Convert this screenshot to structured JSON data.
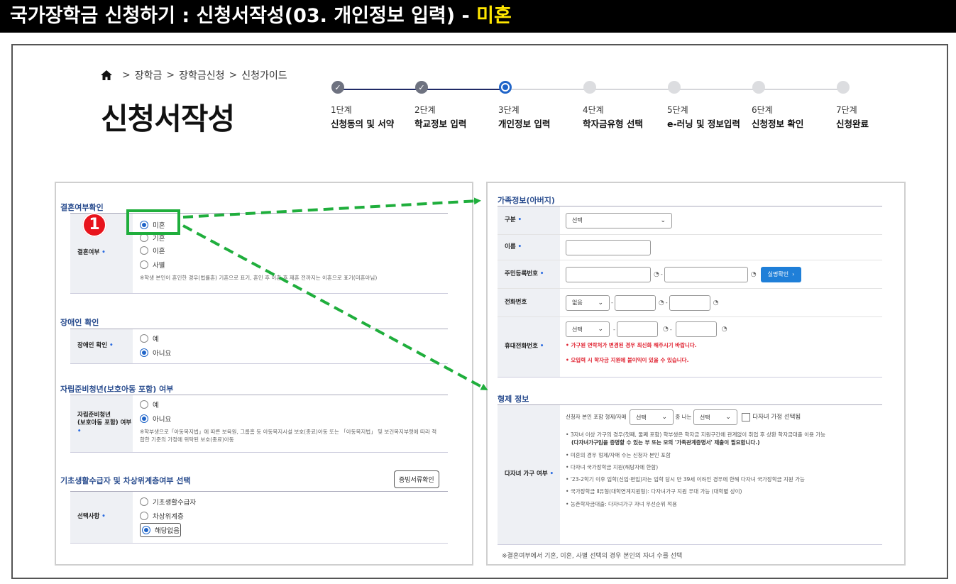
{
  "title_bar": {
    "text": "국가장학금 신청하기 : 신청서작성(03. 개인정보 입력) - ",
    "highlight": "미혼"
  },
  "breadcrumb": {
    "items": [
      "장학금",
      "장학금신청",
      "신청가이드"
    ],
    "separator": ">"
  },
  "page_title": "신청서작성",
  "stepper": {
    "steps": [
      {
        "num": "1단계",
        "name": "신청동의 및 서약",
        "state": "done"
      },
      {
        "num": "2단계",
        "name": "학교정보 입력",
        "state": "done"
      },
      {
        "num": "3단계",
        "name": "개인정보 입력",
        "state": "current"
      },
      {
        "num": "4단계",
        "name": "학자금유형 선택",
        "state": "todo"
      },
      {
        "num": "5단계",
        "name": "e-러닝 및 정보입력",
        "state": "todo"
      },
      {
        "num": "6단계",
        "name": "신청정보 확인",
        "state": "todo"
      },
      {
        "num": "7단계",
        "name": "신청완료",
        "state": "todo"
      }
    ]
  },
  "marriage": {
    "title": "결혼여부확인",
    "label": "결혼여부",
    "options": [
      "미혼",
      "기혼",
      "이혼",
      "사별"
    ],
    "selected": 0,
    "note": "※학생 본인이 혼인한 경우(법률혼) 기혼으로 표기, 혼인 후 이혼 후 재혼 전까지는 이혼으로 표기(미혼아님)"
  },
  "disability": {
    "title": "장애인 확인",
    "label": "장애인 확인",
    "options": [
      "예",
      "아니요"
    ],
    "selected": 1
  },
  "youth": {
    "title": "자립준비청년(보호아동 포함) 여부",
    "label_line1": "자립준비청년",
    "label_line2": "(보호아동 포함) 여부",
    "options": [
      "예",
      "아니요"
    ],
    "selected": 1,
    "note": "※학부생으로「아동복지법」에 따른 보육원, 그룹홈 등 아동복지시설 보호(종료)아동 또는 「아동복지법」 및 보건복지부령에 따라 적합한 기준의 가정에 위탁된 보호(종료)아동"
  },
  "basic_living": {
    "title": "기초생활수급자 및 차상위계층여부 선택",
    "doc_button": "증빙서류확인",
    "label": "선택사항",
    "options": [
      "기초생활수급자",
      "차상위계층",
      "해당없음"
    ],
    "selected": 2
  },
  "family": {
    "title": "가족정보(아버지)",
    "type_label": "구분",
    "type_value": "선택",
    "name_label": "이름",
    "rrn_label": "주민등록번호",
    "verify_button": "실명확인",
    "phone_label": "전화번호",
    "phone_prefix": "없음",
    "mobile_label": "휴대전화번호",
    "mobile_prefix": "선택",
    "notice1": "가구원 연락처가 변경된 경우 최신화 해주시기 바랍니다.",
    "notice2": "오입력 시 학자금 지원에 불이익이 있을 수 있습니다."
  },
  "siblings": {
    "title": "형제 정보",
    "label": "다자녀 가구 여부",
    "line_prefix": "신청자 본인 포함 형제/자매",
    "select1": "선택",
    "line_middle": "중 나는",
    "select2": "선택",
    "check_label": "다자녀 가정 선택됨",
    "bullets": [
      "3자녀 이상 가구의 경우(첫째, 둘째 포함) 학부생은 학자금 지원구간에 관계없이 취업 후 상환 학자금대출 이용 가능",
      "(다자녀가구임을 증명할 수 있는 부 또는 모의 '가족관계증명서' 제출이 필요합니다.)",
      "미혼의 경우 형제/자매 수는 신청자 본인 포함",
      "다자녀 국가장학금 지원(해당자에 한함)",
      "'23-2학기 이후 입학(신입·편입)자는 입학 당시 만 39세 이하인 경우에 한해 다자녀 국가장학금 지원 가능",
      "국가장학금 Ⅱ유형(대학연계지원형): 다자녀가구 지원 우대 가능 (대학별 상이)",
      "농촌학자금대출: 다자녀가구 자녀 우선순위 적용"
    ],
    "footer_note": "※결혼여부에서 기혼, 이혼, 사별 선택의 경우 본인의 자녀 수를 선택"
  },
  "callout": {
    "badge": "1"
  },
  "colors": {
    "accent_blue": "#1f64c8",
    "callout_green": "#1fae3c",
    "badge_red": "#e8141c",
    "highlight_yellow": "#ffe600"
  }
}
